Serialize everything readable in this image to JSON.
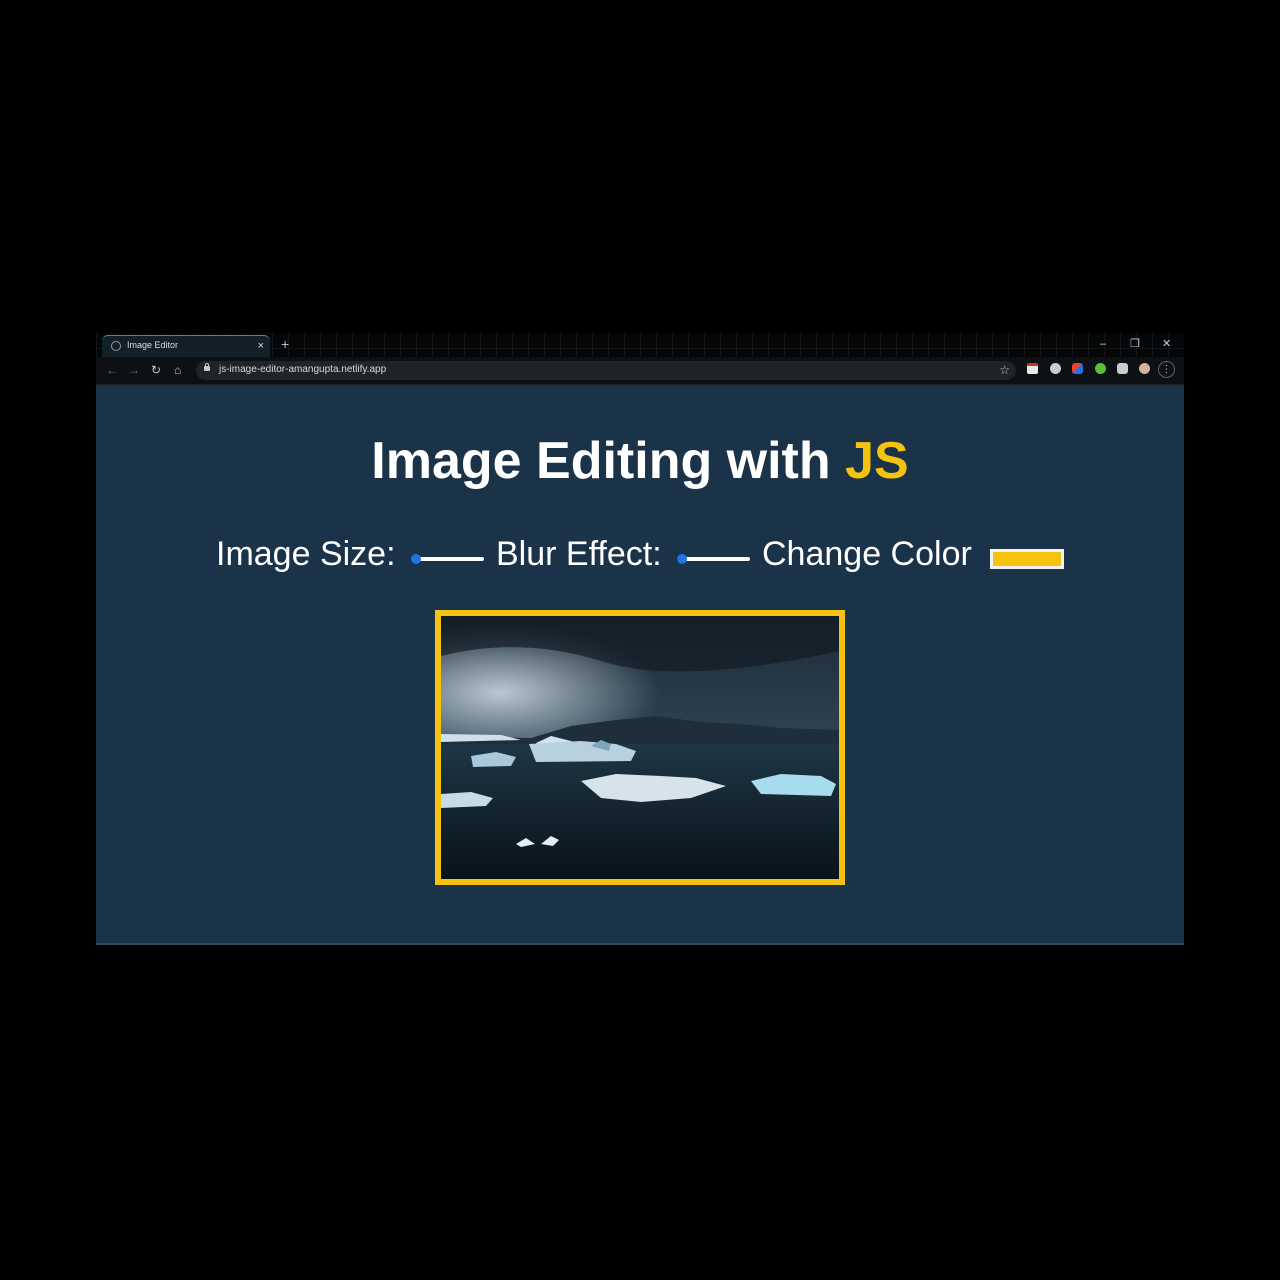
{
  "browser": {
    "tab_title": "Image Editor",
    "tab_close": "×",
    "new_tab": "+",
    "url": "js-image-editor-amangupta.netlify.app",
    "window_controls": {
      "minimize": "–",
      "restore": "❐",
      "close": "✕"
    }
  },
  "page": {
    "heading_main": "Image Editing with ",
    "heading_accent": "JS",
    "image_size_label": "Image Size:",
    "image_size_value": 0,
    "blur_label": "Blur Effect:",
    "blur_value": 0,
    "color_label": "Change Color",
    "color_value": "#f5c20f"
  },
  "colors": {
    "page_background": "#1b3349",
    "accent": "#f5c20f",
    "slider_thumb": "#1f73e6"
  },
  "icons": {
    "favicon": "globe-icon",
    "lock": "lock-icon",
    "star": "star-icon",
    "menu": "kebab-menu-icon"
  }
}
